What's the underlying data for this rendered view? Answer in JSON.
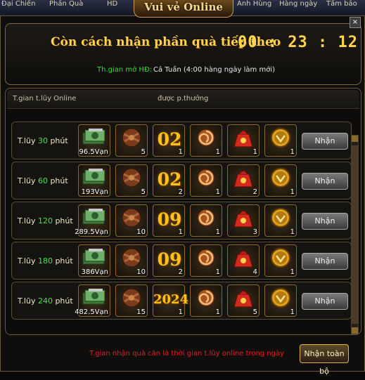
{
  "top_tabs": [
    "Đại Chiến",
    "Phần Quà",
    "HD",
    "Anh Hùng",
    "Hàng ngày",
    "Tấm bảo"
  ],
  "window_title": "Vui vẻ Online",
  "close_label": "×",
  "countdown": {
    "label": "Còn cách nhận phần quà tiếp theo",
    "value": "00 : 23 : 12"
  },
  "open_time": {
    "label": "Th.gian mở HĐ:",
    "value": "Cả Tuần (4:00 hàng ngày làm mới)"
  },
  "list": {
    "col_time": "T.gian t.lũy Online",
    "col_rewards": "được p.thưởng",
    "claim_label": "Nhận",
    "rows": [
      {
        "prefix": "T.lũy ",
        "minutes": "30",
        "suffix": " phút",
        "rewards": [
          {
            "icon": "money-icon",
            "qty": "96.5Vạn"
          },
          {
            "icon": "chest-icon",
            "qty": "5"
          },
          {
            "icon": "number-02-icon",
            "number": "02",
            "qty": "1"
          },
          {
            "icon": "scroll-icon",
            "qty": "1"
          },
          {
            "icon": "red-bag-icon",
            "qty": "1"
          },
          {
            "icon": "gold-coin-icon",
            "qty": "1"
          }
        ]
      },
      {
        "prefix": "T.lũy ",
        "minutes": "60",
        "suffix": " phút",
        "rewards": [
          {
            "icon": "money-icon",
            "qty": "193Vạn"
          },
          {
            "icon": "chest-icon",
            "qty": "5"
          },
          {
            "icon": "number-02-icon",
            "number": "02",
            "qty": "2"
          },
          {
            "icon": "scroll-icon",
            "qty": "1"
          },
          {
            "icon": "red-bag-icon",
            "qty": "2"
          },
          {
            "icon": "gold-coin-icon",
            "qty": "1"
          }
        ]
      },
      {
        "prefix": "T.lũy ",
        "minutes": "120",
        "suffix": " phút",
        "rewards": [
          {
            "icon": "money-icon",
            "qty": "289.5Vạn"
          },
          {
            "icon": "chest-icon",
            "qty": "10"
          },
          {
            "icon": "number-09-icon",
            "number": "09",
            "qty": "1"
          },
          {
            "icon": "scroll-icon",
            "qty": "1"
          },
          {
            "icon": "red-bag-icon",
            "qty": "3"
          },
          {
            "icon": "gold-coin-icon",
            "qty": "1"
          }
        ]
      },
      {
        "prefix": "T.lũy ",
        "minutes": "180",
        "suffix": " phút",
        "rewards": [
          {
            "icon": "money-icon",
            "qty": "386Vạn"
          },
          {
            "icon": "chest-icon",
            "qty": "10"
          },
          {
            "icon": "number-09-icon",
            "number": "09",
            "qty": "2"
          },
          {
            "icon": "scroll-icon",
            "qty": "1"
          },
          {
            "icon": "red-bag-icon",
            "qty": "4"
          },
          {
            "icon": "gold-coin-icon",
            "qty": "1"
          }
        ]
      },
      {
        "prefix": "T.lũy ",
        "minutes": "240",
        "suffix": " phút",
        "rewards": [
          {
            "icon": "money-icon",
            "qty": "482.5Vạn"
          },
          {
            "icon": "chest-icon",
            "qty": "15"
          },
          {
            "icon": "number-2024-icon",
            "number": "2024",
            "qty": "1"
          },
          {
            "icon": "scroll-icon",
            "qty": "1"
          },
          {
            "icon": "red-bag-icon",
            "qty": "5"
          },
          {
            "icon": "gold-coin-icon",
            "qty": "1"
          }
        ]
      }
    ]
  },
  "footer": {
    "note": "T.gian nhận quà căn là thời gian t.lũy online trong ngày",
    "claim_all_label": "Nhận toàn bộ"
  },
  "colors": {
    "title_gold": "#ffd34d",
    "minutes_green": "#48e048",
    "note_red": "#e02020"
  }
}
